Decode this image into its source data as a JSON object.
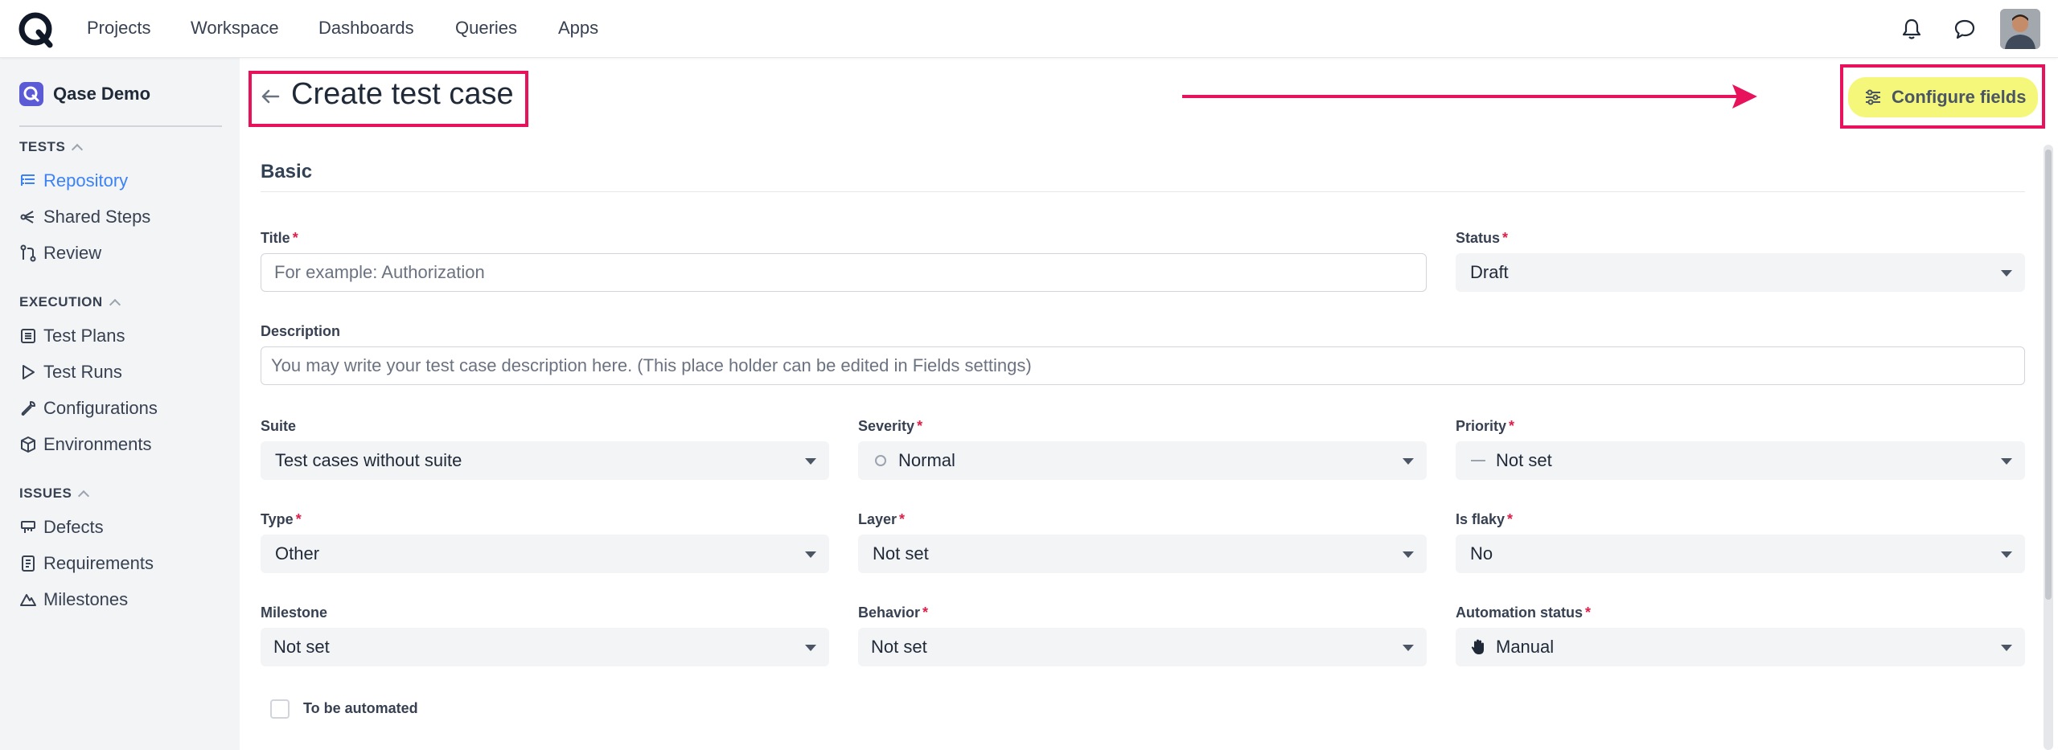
{
  "topnav": {
    "items": [
      "Projects",
      "Workspace",
      "Dashboards",
      "Queries",
      "Apps"
    ],
    "icons": [
      "bell-icon",
      "chat-icon"
    ]
  },
  "sidebar": {
    "project_name": "Qase Demo",
    "sections": {
      "tests": "TESTS",
      "execution": "EXECUTION",
      "issues": "ISSUES"
    },
    "tests_items": [
      "Repository",
      "Shared Steps",
      "Review"
    ],
    "execution_items": [
      "Test Plans",
      "Test Runs",
      "Configurations",
      "Environments"
    ],
    "issues_items": [
      "Defects",
      "Requirements",
      "Milestones"
    ]
  },
  "page": {
    "title": "Create test case",
    "configure_label": "Configure fields",
    "section_basic": "Basic"
  },
  "form": {
    "title_label": "Title",
    "title_placeholder": "For example: Authorization",
    "status_label": "Status",
    "status_value": "Draft",
    "description_label": "Description",
    "description_placeholder": "You may write your test case description here. (This place holder can be edited in Fields settings)",
    "suite_label": "Suite",
    "suite_value": "Test cases without suite",
    "severity_label": "Severity",
    "severity_value": "Normal",
    "priority_label": "Priority",
    "priority_value": "Not set",
    "type_label": "Type",
    "type_value": "Other",
    "layer_label": "Layer",
    "layer_value": "Not set",
    "flaky_label": "Is flaky",
    "flaky_value": "No",
    "milestone_label": "Milestone",
    "milestone_value": "Not set",
    "behavior_label": "Behavior",
    "behavior_value": "Not set",
    "automation_label": "Automation status",
    "automation_value": "Manual",
    "to_be_automated_label": "To be automated"
  },
  "colors": {
    "accent": "#3b82f6",
    "highlight_border": "#e8125c",
    "configure_bg": "#f4f77a",
    "required": "#e11d48"
  }
}
